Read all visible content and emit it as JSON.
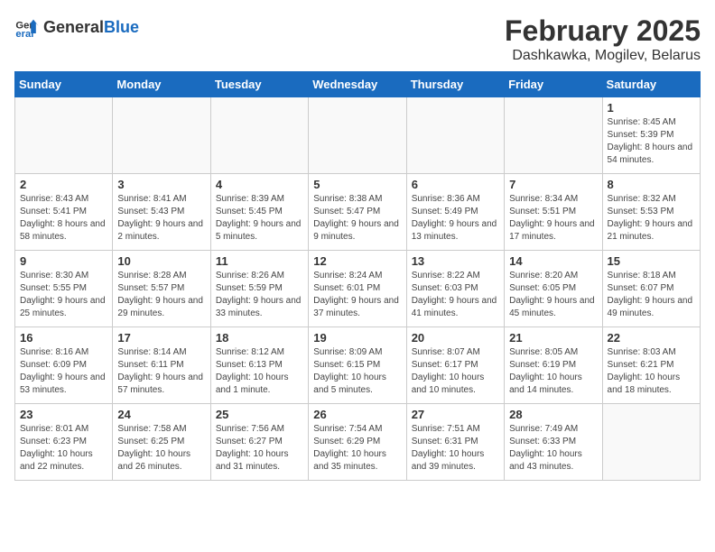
{
  "logo": {
    "general": "General",
    "blue": "Blue"
  },
  "header": {
    "title": "February 2025",
    "subtitle": "Dashkawka, Mogilev, Belarus"
  },
  "weekdays": [
    "Sunday",
    "Monday",
    "Tuesday",
    "Wednesday",
    "Thursday",
    "Friday",
    "Saturday"
  ],
  "weeks": [
    [
      {
        "day": "",
        "detail": ""
      },
      {
        "day": "",
        "detail": ""
      },
      {
        "day": "",
        "detail": ""
      },
      {
        "day": "",
        "detail": ""
      },
      {
        "day": "",
        "detail": ""
      },
      {
        "day": "",
        "detail": ""
      },
      {
        "day": "1",
        "detail": "Sunrise: 8:45 AM\nSunset: 5:39 PM\nDaylight: 8 hours and 54 minutes."
      }
    ],
    [
      {
        "day": "2",
        "detail": "Sunrise: 8:43 AM\nSunset: 5:41 PM\nDaylight: 8 hours and 58 minutes."
      },
      {
        "day": "3",
        "detail": "Sunrise: 8:41 AM\nSunset: 5:43 PM\nDaylight: 9 hours and 2 minutes."
      },
      {
        "day": "4",
        "detail": "Sunrise: 8:39 AM\nSunset: 5:45 PM\nDaylight: 9 hours and 5 minutes."
      },
      {
        "day": "5",
        "detail": "Sunrise: 8:38 AM\nSunset: 5:47 PM\nDaylight: 9 hours and 9 minutes."
      },
      {
        "day": "6",
        "detail": "Sunrise: 8:36 AM\nSunset: 5:49 PM\nDaylight: 9 hours and 13 minutes."
      },
      {
        "day": "7",
        "detail": "Sunrise: 8:34 AM\nSunset: 5:51 PM\nDaylight: 9 hours and 17 minutes."
      },
      {
        "day": "8",
        "detail": "Sunrise: 8:32 AM\nSunset: 5:53 PM\nDaylight: 9 hours and 21 minutes."
      }
    ],
    [
      {
        "day": "9",
        "detail": "Sunrise: 8:30 AM\nSunset: 5:55 PM\nDaylight: 9 hours and 25 minutes."
      },
      {
        "day": "10",
        "detail": "Sunrise: 8:28 AM\nSunset: 5:57 PM\nDaylight: 9 hours and 29 minutes."
      },
      {
        "day": "11",
        "detail": "Sunrise: 8:26 AM\nSunset: 5:59 PM\nDaylight: 9 hours and 33 minutes."
      },
      {
        "day": "12",
        "detail": "Sunrise: 8:24 AM\nSunset: 6:01 PM\nDaylight: 9 hours and 37 minutes."
      },
      {
        "day": "13",
        "detail": "Sunrise: 8:22 AM\nSunset: 6:03 PM\nDaylight: 9 hours and 41 minutes."
      },
      {
        "day": "14",
        "detail": "Sunrise: 8:20 AM\nSunset: 6:05 PM\nDaylight: 9 hours and 45 minutes."
      },
      {
        "day": "15",
        "detail": "Sunrise: 8:18 AM\nSunset: 6:07 PM\nDaylight: 9 hours and 49 minutes."
      }
    ],
    [
      {
        "day": "16",
        "detail": "Sunrise: 8:16 AM\nSunset: 6:09 PM\nDaylight: 9 hours and 53 minutes."
      },
      {
        "day": "17",
        "detail": "Sunrise: 8:14 AM\nSunset: 6:11 PM\nDaylight: 9 hours and 57 minutes."
      },
      {
        "day": "18",
        "detail": "Sunrise: 8:12 AM\nSunset: 6:13 PM\nDaylight: 10 hours and 1 minute."
      },
      {
        "day": "19",
        "detail": "Sunrise: 8:09 AM\nSunset: 6:15 PM\nDaylight: 10 hours and 5 minutes."
      },
      {
        "day": "20",
        "detail": "Sunrise: 8:07 AM\nSunset: 6:17 PM\nDaylight: 10 hours and 10 minutes."
      },
      {
        "day": "21",
        "detail": "Sunrise: 8:05 AM\nSunset: 6:19 PM\nDaylight: 10 hours and 14 minutes."
      },
      {
        "day": "22",
        "detail": "Sunrise: 8:03 AM\nSunset: 6:21 PM\nDaylight: 10 hours and 18 minutes."
      }
    ],
    [
      {
        "day": "23",
        "detail": "Sunrise: 8:01 AM\nSunset: 6:23 PM\nDaylight: 10 hours and 22 minutes."
      },
      {
        "day": "24",
        "detail": "Sunrise: 7:58 AM\nSunset: 6:25 PM\nDaylight: 10 hours and 26 minutes."
      },
      {
        "day": "25",
        "detail": "Sunrise: 7:56 AM\nSunset: 6:27 PM\nDaylight: 10 hours and 31 minutes."
      },
      {
        "day": "26",
        "detail": "Sunrise: 7:54 AM\nSunset: 6:29 PM\nDaylight: 10 hours and 35 minutes."
      },
      {
        "day": "27",
        "detail": "Sunrise: 7:51 AM\nSunset: 6:31 PM\nDaylight: 10 hours and 39 minutes."
      },
      {
        "day": "28",
        "detail": "Sunrise: 7:49 AM\nSunset: 6:33 PM\nDaylight: 10 hours and 43 minutes."
      },
      {
        "day": "",
        "detail": ""
      }
    ]
  ]
}
